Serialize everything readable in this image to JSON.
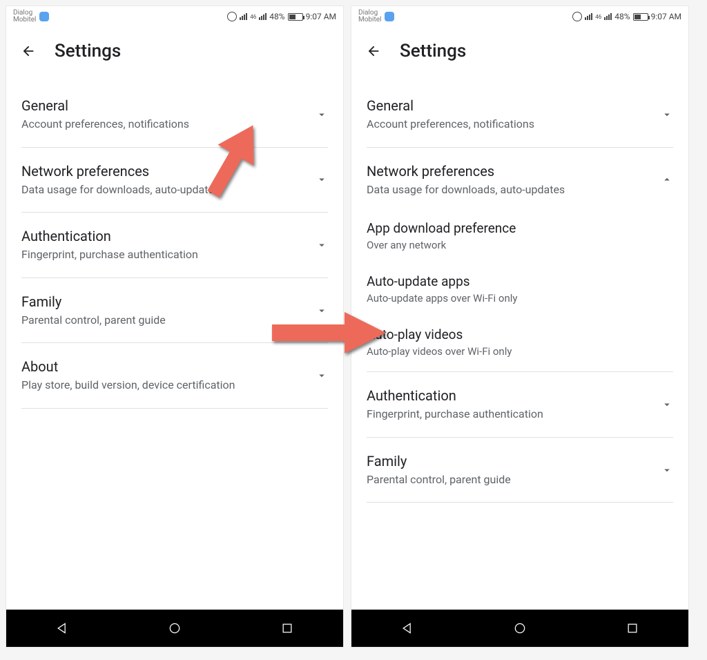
{
  "statusbar": {
    "carrier1": "Dialog",
    "carrier2": "Mobitel",
    "battery": "48%",
    "time": "9:07 AM",
    "signal_label": "46"
  },
  "header": {
    "title": "Settings"
  },
  "left_screen": {
    "items": [
      {
        "title": "General",
        "subtitle": "Account preferences, notifications",
        "expanded": false
      },
      {
        "title": "Network preferences",
        "subtitle": "Data usage for downloads, auto-updates",
        "expanded": false
      },
      {
        "title": "Authentication",
        "subtitle": "Fingerprint, purchase authentication",
        "expanded": false
      },
      {
        "title": "Family",
        "subtitle": "Parental control, parent guide",
        "expanded": false
      },
      {
        "title": "About",
        "subtitle": "Play store, build version, device certification",
        "expanded": false
      }
    ]
  },
  "right_screen": {
    "items": [
      {
        "title": "General",
        "subtitle": "Account preferences, notifications",
        "expanded": false
      },
      {
        "title": "Network preferences",
        "subtitle": "Data usage for downloads, auto-updates",
        "expanded": true,
        "subitems": [
          {
            "title": "App download preference",
            "subtitle": "Over any network"
          },
          {
            "title": "Auto-update apps",
            "subtitle": "Auto-update apps over Wi-Fi only"
          },
          {
            "title": "Auto-play videos",
            "subtitle": "Auto-play videos over Wi-Fi only"
          }
        ]
      },
      {
        "title": "Authentication",
        "subtitle": "Fingerprint, purchase authentication",
        "expanded": false
      },
      {
        "title": "Family",
        "subtitle": "Parental control, parent guide",
        "expanded": false
      }
    ]
  },
  "annotations": {
    "arrow_color": "#ed6a5a"
  }
}
